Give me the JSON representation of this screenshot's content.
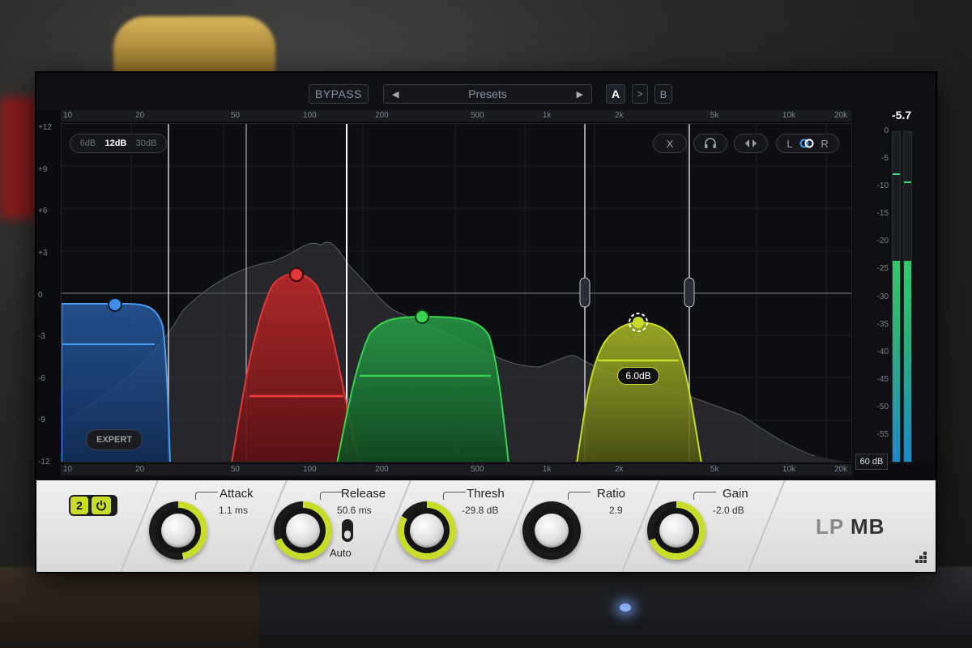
{
  "toolbar": {
    "bypass_label": "BYPASS",
    "presets_label": "Presets",
    "prev_arrow": "◀",
    "next_arrow": "▶",
    "ab_a_label": "A",
    "ab_copy_label": ">",
    "ab_b_label": "B"
  },
  "frequency_scale": [
    "10",
    "20",
    "50",
    "100",
    "200",
    "500",
    "1k",
    "2k",
    "5k",
    "10k",
    "20k"
  ],
  "db_scale": [
    "+12",
    "+9",
    "+6",
    "+3",
    "0",
    "-3",
    "-6",
    "-9",
    "-12"
  ],
  "graph": {
    "range_options": [
      "6dB",
      "12dB",
      "30dB"
    ],
    "range_selected": "12dB",
    "expert_label": "EXPERT",
    "band_gain_tag": "6.0dB",
    "controls": {
      "mute_label": "X",
      "solo_icon": "headphones-icon",
      "delta_icon": "arrows-icon",
      "l_label": "L",
      "link_icon": "link-icon",
      "r_label": "R"
    }
  },
  "meter": {
    "peak_value": "-5.7",
    "scale": [
      "0",
      "-5",
      "-10",
      "-15",
      "-20",
      "-25",
      "-30",
      "-35",
      "-40",
      "-45",
      "-50",
      "-55"
    ],
    "range_label": "60 dB",
    "left_level_db": -23.5,
    "right_level_db": -23.5,
    "left_hold_db": -7.5,
    "right_hold_db": -9
  },
  "bottom_panel": {
    "band_number": "2",
    "power_icon": "power-icon",
    "params": [
      {
        "name": "Attack",
        "value": "1.1 ms"
      },
      {
        "name": "Release",
        "value": "50.6 ms"
      },
      {
        "name": "Thresh",
        "value": "-29.8 dB"
      },
      {
        "name": "Ratio",
        "value": "2.9"
      },
      {
        "name": "Gain",
        "value": "-2.0 dB"
      }
    ],
    "auto_label": "Auto",
    "logo_lp": "LP",
    "logo_mb": "MB"
  },
  "colors": {
    "band1": "#3f8fe8",
    "band2": "#e23838",
    "band3": "#39d250",
    "band4": "#c8dc2a",
    "accent": "#c8dc2a"
  }
}
